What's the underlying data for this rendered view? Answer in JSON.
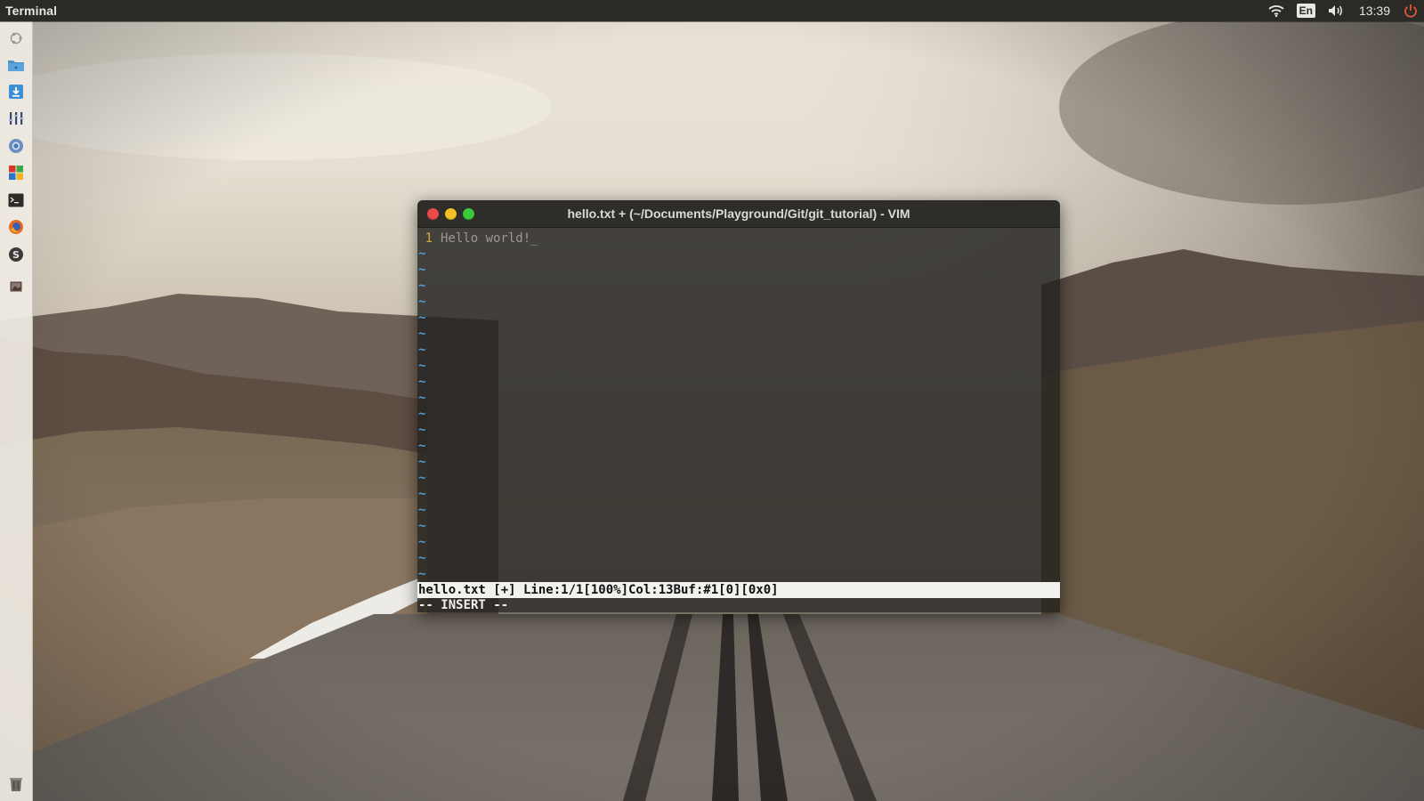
{
  "top_panel": {
    "app_name": "Terminal",
    "keyboard_layout": "En",
    "clock": "13:39",
    "icons": [
      "wifi-icon",
      "keyboard-layout-indicator",
      "volume-icon",
      "power-icon"
    ]
  },
  "launcher": {
    "items": [
      {
        "name": "dash-home",
        "icon": "ubuntu-logo-icon"
      },
      {
        "name": "files",
        "icon": "home-folder-icon"
      },
      {
        "name": "downloads",
        "icon": "download-icon"
      },
      {
        "name": "system-monitor",
        "icon": "equalizer-icon"
      },
      {
        "name": "chromium",
        "icon": "chromium-icon"
      },
      {
        "name": "libreoffice",
        "icon": "office-suite-icon"
      },
      {
        "name": "terminal",
        "icon": "terminal-icon"
      },
      {
        "name": "firefox",
        "icon": "firefox-icon"
      },
      {
        "name": "software-center",
        "icon": "software-center-icon"
      },
      {
        "name": "image-viewer",
        "icon": "image-icon"
      },
      {
        "name": "trash",
        "icon": "trash-icon"
      }
    ]
  },
  "vim": {
    "window_title": "hello.txt + (~/Documents/Playground/Git/git_tutorial) - VIM",
    "line_number": "1",
    "line_text": "Hello world!",
    "cursor_char": "_",
    "empty_line_marker": "~",
    "empty_line_count": 21,
    "status_line": "hello.txt [+] Line:1/1[100%]Col:13Buf:#1[0][0x0]",
    "mode_line": "-- INSERT --"
  },
  "colors": {
    "panel_bg": "#2b2a27",
    "launcher_bg": "#f0ebe4",
    "close_button": "#e84a4a",
    "minimize_button": "#f5bf26",
    "maximize_button": "#3ac93d",
    "line_number": "#d6a93a",
    "tilde": "#4f9fd8",
    "status_bg": "#f2f1ee"
  }
}
